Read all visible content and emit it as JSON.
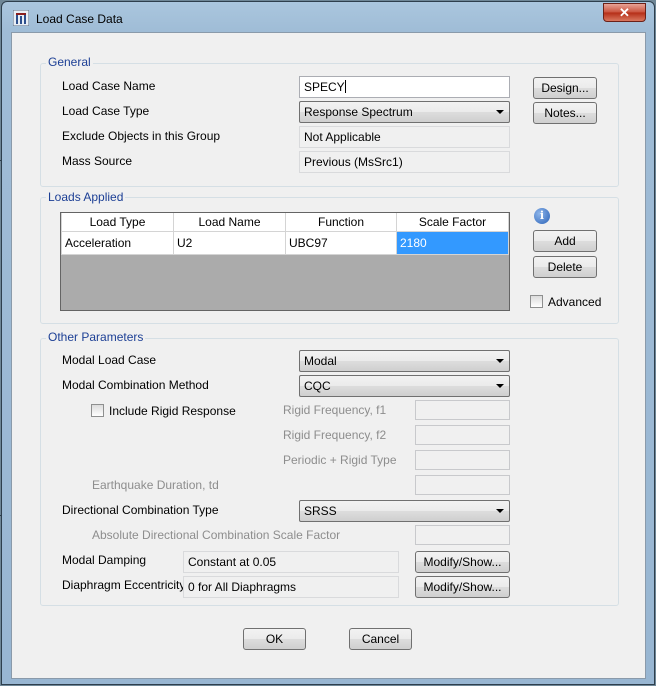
{
  "window": {
    "title": "Load Case Data",
    "close_glyph": "✕"
  },
  "general": {
    "title": "General",
    "load_case_name_label": "Load Case Name",
    "load_case_name_value": "SPECY",
    "load_case_type_label": "Load Case Type",
    "load_case_type_value": "Response Spectrum",
    "exclude_label": "Exclude Objects in this Group",
    "exclude_value": "Not Applicable",
    "mass_source_label": "Mass Source",
    "mass_source_value": "Previous  (MsSrc1)",
    "design_button": "Design...",
    "notes_button": "Notes..."
  },
  "loads_applied": {
    "title": "Loads Applied",
    "columns": [
      "Load Type",
      "Load Name",
      "Function",
      "Scale Factor"
    ],
    "rows": [
      {
        "load_type": "Acceleration",
        "load_name": "U2",
        "function": "UBC97",
        "scale_factor": "2180"
      }
    ],
    "add_button": "Add",
    "delete_button": "Delete",
    "advanced_label": "Advanced",
    "advanced_checked": false
  },
  "other": {
    "title": "Other Parameters",
    "modal_load_case_label": "Modal Load Case",
    "modal_load_case_value": "Modal",
    "modal_combination_label": "Modal Combination Method",
    "modal_combination_value": "CQC",
    "include_rigid_label": "Include Rigid Response",
    "include_rigid_checked": false,
    "rigid_f1_label": "Rigid Frequency, f1",
    "rigid_f2_label": "Rigid Frequency, f2",
    "periodic_rigid_label": "Periodic + Rigid Type",
    "earthquake_duration_label": "Earthquake Duration, td",
    "directional_combination_label": "Directional Combination Type",
    "directional_combination_value": "SRSS",
    "abs_dir_scale_label": "Absolute Directional Combination Scale Factor",
    "modal_damping_label": "Modal Damping",
    "modal_damping_value": "Constant at 0.05",
    "diaphragm_label": "Diaphragm Eccentricity",
    "diaphragm_value": "0 for All Diaphragms",
    "modify_show_button": "Modify/Show..."
  },
  "footer": {
    "ok_button": "OK",
    "cancel_button": "Cancel"
  },
  "colors": {
    "selection": "#3399ff",
    "group_title": "#1c3f95",
    "info_icon": "#2a62b8"
  },
  "icons": [
    "app-icon",
    "close-icon",
    "dropdown-arrow-icon",
    "info-icon",
    "checkbox-icon"
  ]
}
